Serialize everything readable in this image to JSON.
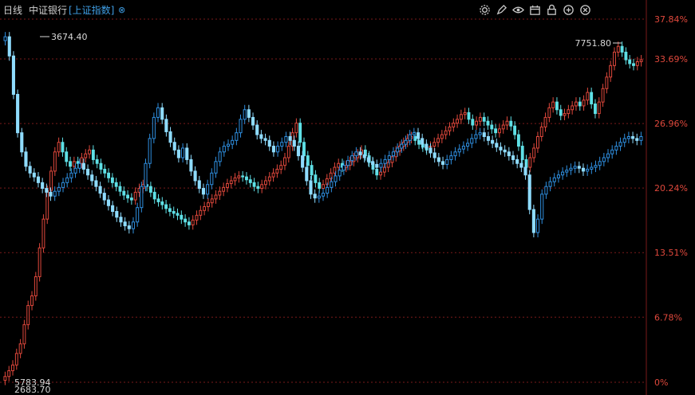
{
  "header": {
    "period": "日线",
    "stock_name": "中证银行",
    "compare_label": "[上证指数]",
    "close_glyph": "⊗"
  },
  "toolbar": {
    "icons": [
      "settings-icon",
      "draw-pen-icon",
      "visibility-eye-icon",
      "calendar-icon",
      "lock-icon",
      "zoom-in-icon",
      "close-icon"
    ]
  },
  "chart_data": {
    "type": "candlestick",
    "y_axis_side": "right",
    "y_axis_unit": "percent change",
    "y_ticks": [
      "37.84%",
      "33.69%",
      "26.96%",
      "20.24%",
      "13.51%",
      "6.78%",
      "0%"
    ],
    "y_tick_values": [
      37.84,
      33.69,
      26.96,
      20.24,
      13.51,
      6.78,
      0
    ],
    "ylim": [
      0,
      37.84
    ],
    "grid": "horizontal dotted",
    "annotations": {
      "bank_high": "3674.40",
      "bank_low": "5783.94",
      "index_high": "7751.80",
      "index_low": "2683.70"
    },
    "colors": {
      "up": "#e0483c",
      "down": "#5fe0e6",
      "index_up": "#2f8fe0",
      "index_down": "#8fdcff",
      "axis_text": "#e0483c",
      "grid": "#7a1a1a"
    },
    "series": [
      {
        "name": "中证银行",
        "percent_close": [
          0.6,
          1.2,
          1.8,
          3,
          4,
          6,
          8,
          9,
          11,
          14,
          17,
          20,
          22,
          24,
          25,
          24,
          23,
          22.5,
          23,
          22.8,
          23.4,
          23.8,
          24.2,
          23.2,
          22.8,
          22.2,
          21.8,
          21.3,
          20.8,
          20.4,
          19.9,
          19.5,
          19.2,
          19.0,
          19.8,
          20.2,
          20.6,
          20.4,
          19.8,
          19.1,
          18.8,
          18.5,
          18.1,
          17.8,
          17.6,
          17.4,
          17.0,
          16.7,
          16.4,
          16.9,
          17.4,
          17.9,
          18.3,
          18.7,
          19.1,
          19.5,
          19.9,
          20.3,
          20.7,
          21.0,
          21.3,
          21.5,
          21.4,
          21.1,
          20.8,
          20.4,
          20.2,
          20.6,
          21.0,
          21.4,
          21.8,
          22.2,
          22.6,
          23.4,
          24.6,
          26.0,
          27.0,
          25.0,
          23.6,
          22.6,
          21.6,
          20.8,
          20.2,
          20.6,
          21.2,
          21.8,
          22.4,
          22.8,
          22.4,
          22.6,
          23.0,
          23.4,
          23.8,
          24.2,
          23.6,
          22.9,
          22.2,
          21.6,
          21.9,
          22.4,
          22.9,
          23.5,
          24.1,
          24.6,
          25.0,
          25.4,
          25.6,
          25.2,
          24.8,
          24.5,
          24.2,
          24.6,
          25.0,
          25.4,
          25.8,
          26.2,
          26.6,
          27.0,
          27.4,
          27.9,
          28.1,
          27.4,
          26.8,
          27.2,
          27.6,
          27.2,
          26.8,
          26.4,
          26.0,
          26.4,
          26.8,
          27.2,
          26.7,
          25.8,
          24.6,
          23.2,
          22.4,
          23.4,
          24.4,
          25.6,
          26.6,
          27.6,
          28.6,
          29.2,
          28.4,
          27.8,
          28.0,
          28.4,
          28.8,
          29.2,
          28.8,
          29.4,
          30.2,
          29.0,
          28.0,
          29.2,
          30.6,
          31.8,
          33.0,
          34.4,
          35.0,
          34.4,
          33.6,
          33.2,
          33.0,
          33.4,
          33.6
        ]
      },
      {
        "name": "上证指数",
        "percent_close": [
          36.0,
          34.0,
          30.0,
          26.0,
          24.0,
          22.5,
          21.8,
          21.4,
          20.8,
          20.2,
          19.8,
          19.4,
          19.9,
          20.3,
          20.8,
          21.3,
          21.8,
          22.3,
          22.8,
          22.2,
          21.6,
          21.0,
          20.4,
          19.7,
          19.0,
          18.4,
          17.8,
          17.2,
          16.7,
          16.3,
          16.0,
          16.7,
          18.2,
          20.4,
          22.8,
          25.4,
          27.6,
          28.6,
          27.4,
          26.1,
          25.0,
          24.2,
          23.4,
          24.4,
          23.2,
          22.0,
          21.0,
          20.2,
          19.6,
          20.6,
          21.8,
          23.0,
          24.0,
          24.6,
          24.8,
          25.2,
          26.0,
          27.4,
          28.4,
          27.6,
          26.8,
          25.8,
          25.4,
          25.2,
          24.6,
          24.0,
          24.6,
          25.0,
          25.6,
          25.2,
          24.6,
          23.6,
          22.4,
          21.0,
          19.6,
          19.2,
          19.4,
          19.7,
          20.3,
          20.9,
          21.5,
          22.1,
          22.6,
          23.1,
          23.6,
          24.0,
          23.7,
          23.4,
          23.0,
          22.7,
          22.4,
          22.8,
          23.2,
          23.6,
          24.0,
          24.4,
          24.8,
          25.2,
          25.8,
          26.0,
          25.4,
          24.8,
          24.4,
          23.9,
          23.4,
          23.0,
          22.7,
          23.2,
          23.6,
          24.0,
          24.3,
          24.6,
          24.9,
          25.4,
          25.8,
          26.0,
          25.6,
          25.2,
          24.9,
          24.5,
          24.2,
          24.0,
          23.6,
          23.2,
          22.8,
          22.4,
          21.6,
          18.0,
          15.6,
          17.0,
          19.6,
          20.4,
          20.9,
          21.3,
          21.6,
          21.9,
          22.1,
          22.3,
          22.5,
          22.3,
          22.0,
          22.2,
          22.4,
          22.6,
          23.0,
          23.4,
          23.8,
          24.2,
          24.6,
          25.0,
          25.4,
          25.6,
          25.4,
          25.2,
          25.6
        ]
      }
    ]
  }
}
